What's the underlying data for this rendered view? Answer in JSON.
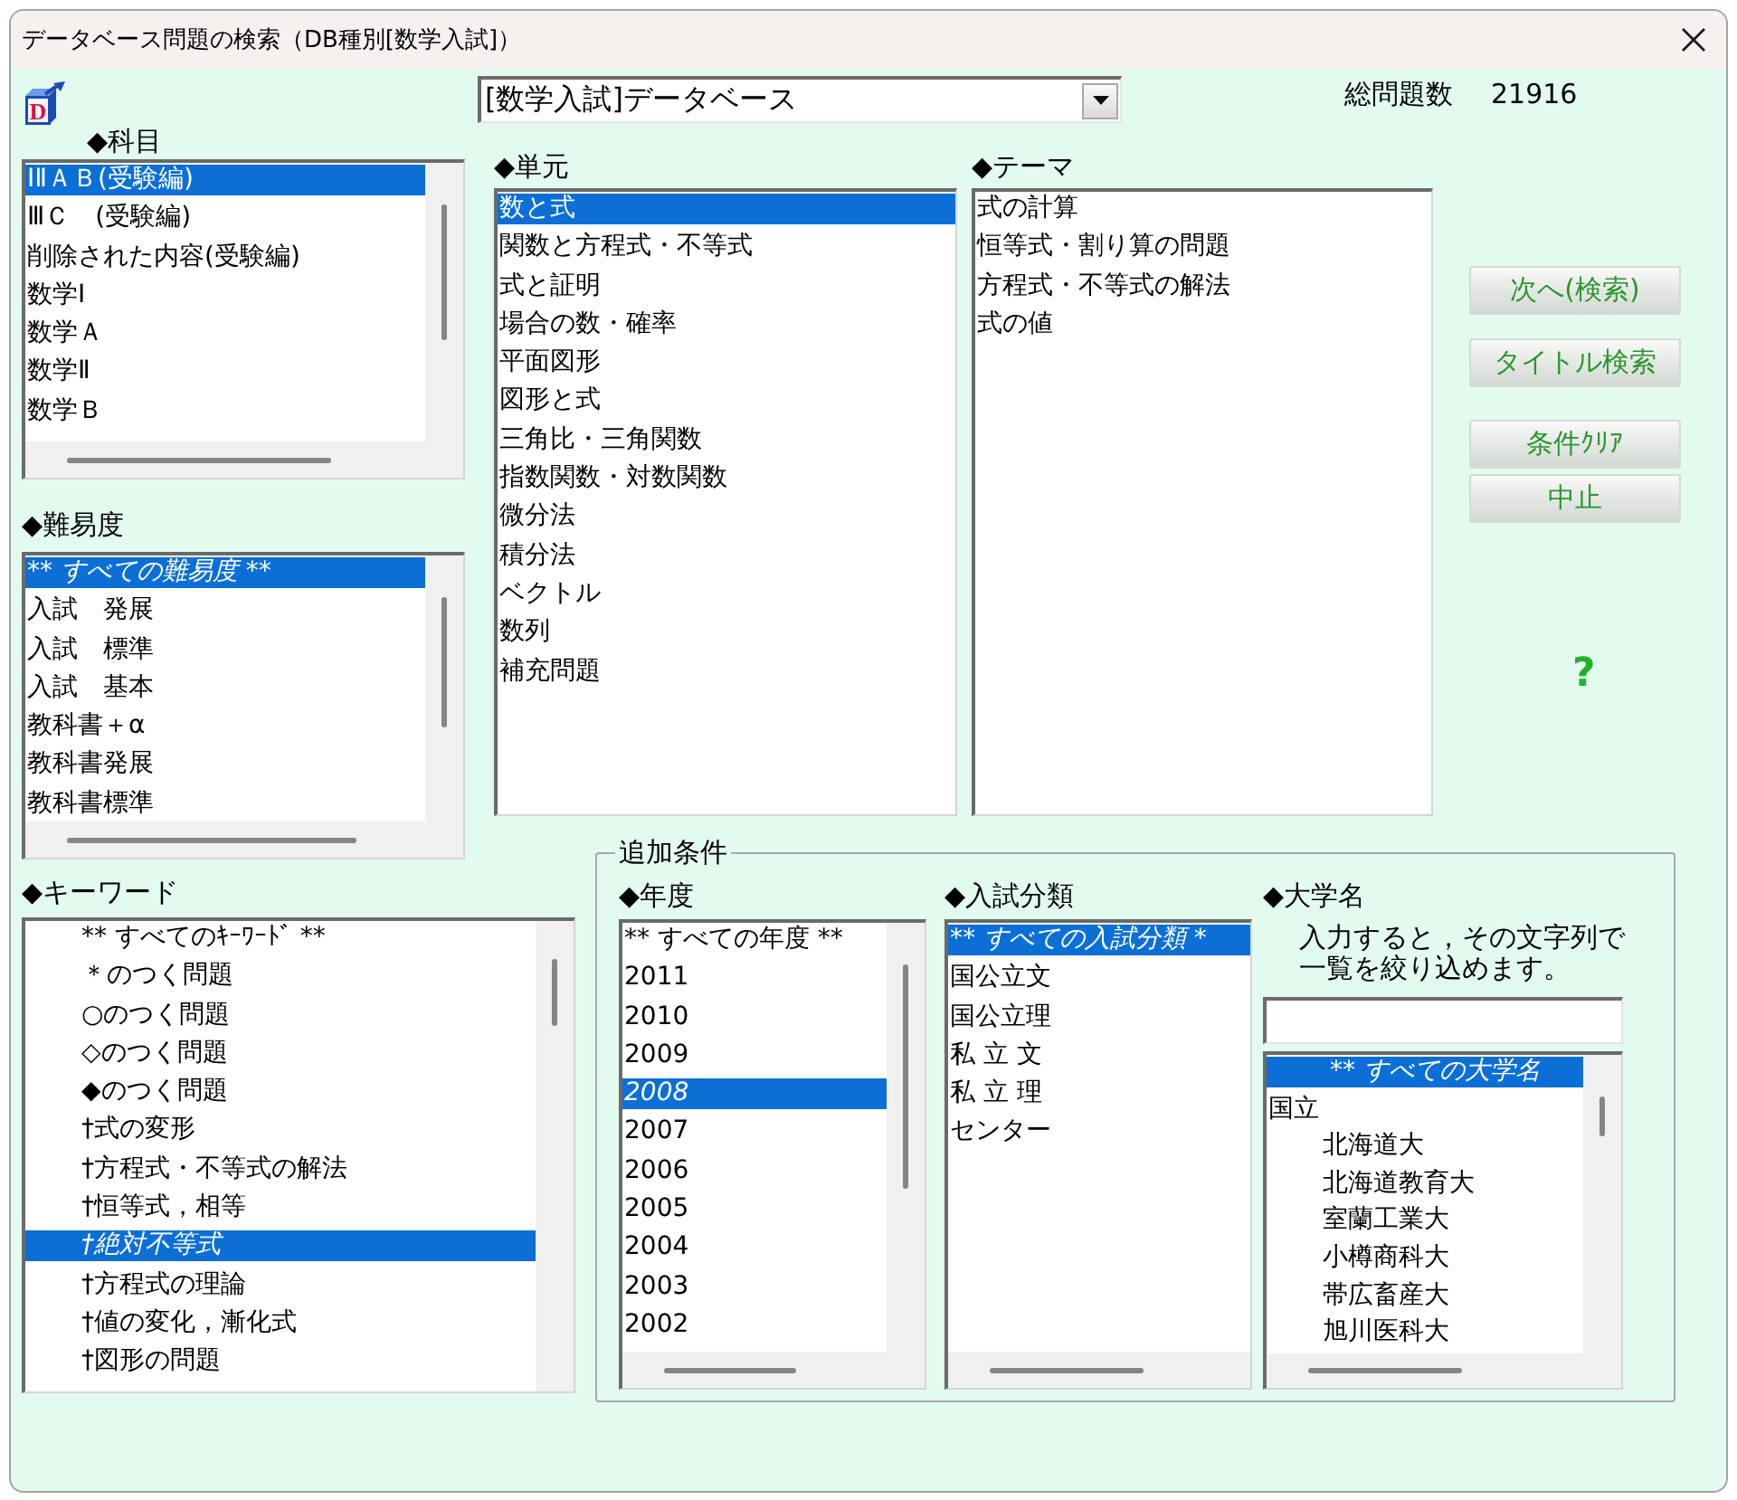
{
  "window": {
    "title": "データベース問題の検索（DB種別[数学入試]）"
  },
  "app_icon": {
    "letter": "D"
  },
  "database_select": {
    "value": "[数学入試]データベース"
  },
  "total": {
    "label": "総問題数",
    "value": "21916"
  },
  "subject": {
    "label": "◆科目",
    "items": [
      {
        "text": "ⅠⅡＡＢ(受験編)",
        "selected": true
      },
      {
        "text": "ⅢＣ　(受験編)",
        "selected": false
      },
      {
        "text": "削除された内容(受験編)",
        "selected": false
      },
      {
        "text": "数学Ⅰ",
        "selected": false
      },
      {
        "text": "数学Ａ",
        "selected": false
      },
      {
        "text": "数学Ⅱ",
        "selected": false
      },
      {
        "text": "数学Ｂ",
        "selected": false
      }
    ]
  },
  "difficulty": {
    "label": "◆難易度",
    "items": [
      {
        "text": "** すべての難易度 **",
        "selected": true
      },
      {
        "text": "入試　発展",
        "selected": false
      },
      {
        "text": "入試　標準",
        "selected": false
      },
      {
        "text": "入試　基本",
        "selected": false
      },
      {
        "text": "教科書＋α",
        "selected": false
      },
      {
        "text": "教科書発展",
        "selected": false
      },
      {
        "text": "教科書標準",
        "selected": false
      }
    ]
  },
  "unit": {
    "label": "◆単元",
    "items": [
      {
        "text": "数と式",
        "selected": true
      },
      {
        "text": "関数と方程式・不等式",
        "selected": false
      },
      {
        "text": "式と証明",
        "selected": false
      },
      {
        "text": "場合の数・確率",
        "selected": false
      },
      {
        "text": "平面図形",
        "selected": false
      },
      {
        "text": "図形と式",
        "selected": false
      },
      {
        "text": "三角比・三角関数",
        "selected": false
      },
      {
        "text": "指数関数・対数関数",
        "selected": false
      },
      {
        "text": "微分法",
        "selected": false
      },
      {
        "text": "積分法",
        "selected": false
      },
      {
        "text": "ベクトル",
        "selected": false
      },
      {
        "text": "数列",
        "selected": false
      },
      {
        "text": "補充問題",
        "selected": false
      }
    ]
  },
  "theme": {
    "label": "◆テーマ",
    "items": [
      {
        "text": "式の計算",
        "selected": false
      },
      {
        "text": "恒等式・割り算の問題",
        "selected": false
      },
      {
        "text": "方程式・不等式の解法",
        "selected": false
      },
      {
        "text": "式の値",
        "selected": false
      }
    ]
  },
  "buttons": [
    {
      "label": "次へ(検索)"
    },
    {
      "label": "タイトル検索"
    },
    {
      "label": "条件ｸﾘｱ"
    },
    {
      "label": "中止"
    }
  ],
  "help": {
    "label": "?"
  },
  "keyword": {
    "label": "◆キーワード",
    "items": [
      {
        "text": "** すべてのｷｰﾜｰﾄﾞ **",
        "selected": false
      },
      {
        "text": "＊のつく問題",
        "selected": false
      },
      {
        "text": "○のつく問題",
        "selected": false
      },
      {
        "text": "◇のつく問題",
        "selected": false
      },
      {
        "text": "◆のつく問題",
        "selected": false
      },
      {
        "text": "†式の変形",
        "selected": false
      },
      {
        "text": "†方程式・不等式の解法",
        "selected": false
      },
      {
        "text": "†恒等式，相等",
        "selected": false
      },
      {
        "text": "†絶対不等式",
        "selected": true
      },
      {
        "text": "†方程式の理論",
        "selected": false
      },
      {
        "text": "†値の変化，漸化式",
        "selected": false
      },
      {
        "text": "†図形の問題",
        "selected": false
      }
    ]
  },
  "additional_conditions": {
    "legend": "追加条件",
    "year": {
      "label": "◆年度",
      "items": [
        {
          "text": "** すべての年度 **",
          "selected": false
        },
        {
          "text": "2011",
          "selected": false
        },
        {
          "text": "2010",
          "selected": false
        },
        {
          "text": "2009",
          "selected": false
        },
        {
          "text": "2008",
          "selected": true
        },
        {
          "text": "2007",
          "selected": false
        },
        {
          "text": "2006",
          "selected": false
        },
        {
          "text": "2005",
          "selected": false
        },
        {
          "text": "2004",
          "selected": false
        },
        {
          "text": "2003",
          "selected": false
        },
        {
          "text": "2002",
          "selected": false
        }
      ]
    },
    "exam_type": {
      "label": "◆入試分類",
      "items": [
        {
          "text": "** すべての入試分類 *",
          "selected": true
        },
        {
          "text": "国公立文",
          "selected": false
        },
        {
          "text": "国公立理",
          "selected": false
        },
        {
          "text": "私 立 文",
          "selected": false
        },
        {
          "text": "私 立 理",
          "selected": false
        },
        {
          "text": "センター",
          "selected": false
        }
      ]
    },
    "university": {
      "label": "◆大学名",
      "hint": "入力すると，その文字列で一覧を絞り込めます。",
      "items": [
        {
          "kind": "all",
          "text": "** すべての大学名",
          "selected": true
        },
        {
          "kind": "group",
          "text": "国立",
          "selected": false,
          "children": [
            {
              "text": "北海道大",
              "selected": false
            },
            {
              "text": "北海道教育大",
              "selected": false
            },
            {
              "text": "室蘭工業大",
              "selected": false
            },
            {
              "text": "小樽商科大",
              "selected": false
            },
            {
              "text": "帯広畜産大",
              "selected": false
            },
            {
              "text": "旭川医科大",
              "selected": false
            }
          ]
        }
      ]
    }
  }
}
